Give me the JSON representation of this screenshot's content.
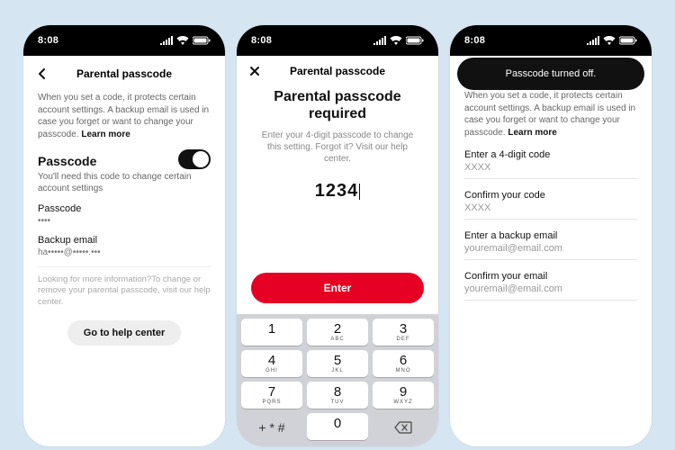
{
  "status": {
    "time": "8:08"
  },
  "screen1": {
    "nav_title": "Parental passcode",
    "desc": "When you set a code, it protects certain account settings. A backup email is used in case you forget or want to change your passcode.",
    "learn_more": "Learn more",
    "section_title": "Passcode",
    "section_sub": "You'll need this code to change certain account settings",
    "passcode_label": "Passcode",
    "passcode_value": "••••",
    "email_label": "Backup email",
    "email_value": "ha•••••@•••••.•••",
    "help_text": "Looking for more information?To change or remove your parental passcode, visit our help center.",
    "help_button": "Go to help center"
  },
  "screen2": {
    "nav_title": "Parental passcode",
    "title": "Parental passcode required",
    "desc": "Enter your 4-digit passcode to change this setting. Forgot it? Visit our help center.",
    "code": "1234",
    "enter": "Enter",
    "keys": [
      {
        "n": "1",
        "s": ""
      },
      {
        "n": "2",
        "s": "ABC"
      },
      {
        "n": "3",
        "s": "DEF"
      },
      {
        "n": "4",
        "s": "GHI"
      },
      {
        "n": "5",
        "s": "JKL"
      },
      {
        "n": "6",
        "s": "MNO"
      },
      {
        "n": "7",
        "s": "PQRS"
      },
      {
        "n": "8",
        "s": "TUV"
      },
      {
        "n": "9",
        "s": "WXYZ"
      },
      {
        "n": "0",
        "s": ""
      }
    ]
  },
  "screen3": {
    "toast": "Passcode turned off.",
    "desc": "When you set a code, it protects certain account settings. A backup email is used in case you forget or want to change your passcode.",
    "learn_more": "Learn more",
    "enter_code_label": "Enter a 4-digit code",
    "enter_code_value": "XXXX",
    "confirm_code_label": "Confirm your code",
    "confirm_code_value": "XXXX",
    "enter_email_label": "Enter a backup email",
    "enter_email_value": "youremail@email.com",
    "confirm_email_label": "Confirm your email",
    "confirm_email_value": "youremail@email.com"
  }
}
